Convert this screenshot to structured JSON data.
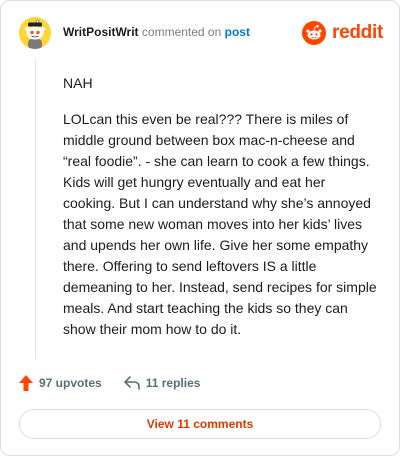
{
  "header": {
    "username": "WritPositWrit",
    "action_text": "commented on",
    "post_link": "post"
  },
  "brand": {
    "name": "reddit",
    "color": "#ff4500",
    "icon": "reddit-logo-icon"
  },
  "comment": {
    "verdict": "NAH",
    "body": "LOLcan this even be real??? There is miles of middle ground between box mac-n-cheese and “real foodie”. - she can learn to cook a few things. Kids will get hungry eventually and eat her cooking. But I can understand why she’s annoyed that some new woman moves into her kids’ lives and upends her own life. Give her some empathy there. Offering to send leftovers IS a little demeaning to her. Instead, send recipes for simple meals. And start teaching the kids so they can show their mom how to do it."
  },
  "actions": {
    "upvotes_label": "97 upvotes",
    "upvote_icon": "upvote-arrow-icon",
    "upvote_color": "#ff4500",
    "replies_label": "11 replies",
    "reply_icon": "reply-arrow-icon"
  },
  "footer": {
    "view_comments_label": "View 11 comments",
    "accent_color": "#d93a00"
  },
  "avatar": {
    "icon": "snoo-avatar-icon",
    "background": "#ffd635"
  }
}
